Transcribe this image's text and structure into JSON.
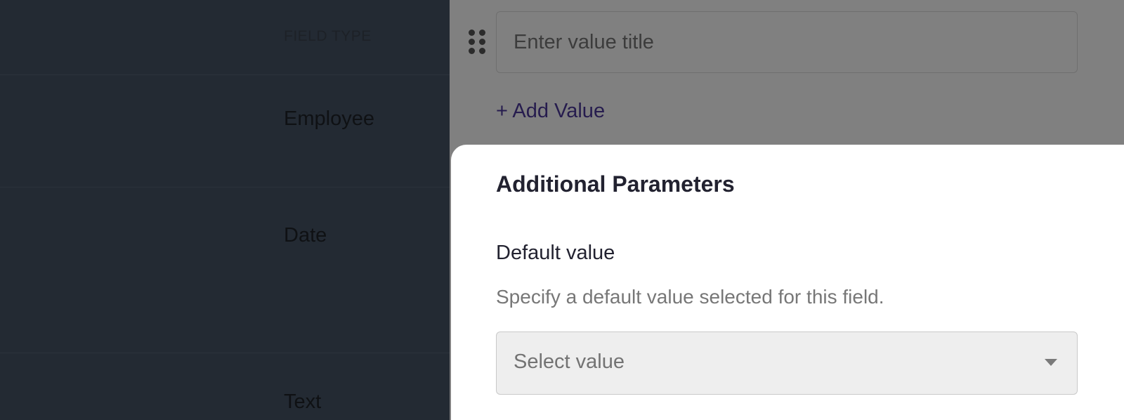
{
  "table": {
    "header": "FIELD TYPE",
    "rows": [
      {
        "type": "Employee"
      },
      {
        "type": "Date"
      },
      {
        "type": "Text"
      }
    ]
  },
  "panel": {
    "value_title_placeholder": "Enter value title",
    "add_value_label": "+ Add Value",
    "additional": {
      "title": "Additional Parameters",
      "default_label": "Default value",
      "default_help": "Specify a default value selected for this field.",
      "select_placeholder": "Select value"
    }
  },
  "icons": {
    "drag": "drag-handle-icon",
    "caret": "caret-down-icon"
  },
  "colors": {
    "overlay_dark": "#232a33",
    "overlay_gray": "#808080",
    "link": "#261c4e",
    "card": "#ffffff"
  }
}
